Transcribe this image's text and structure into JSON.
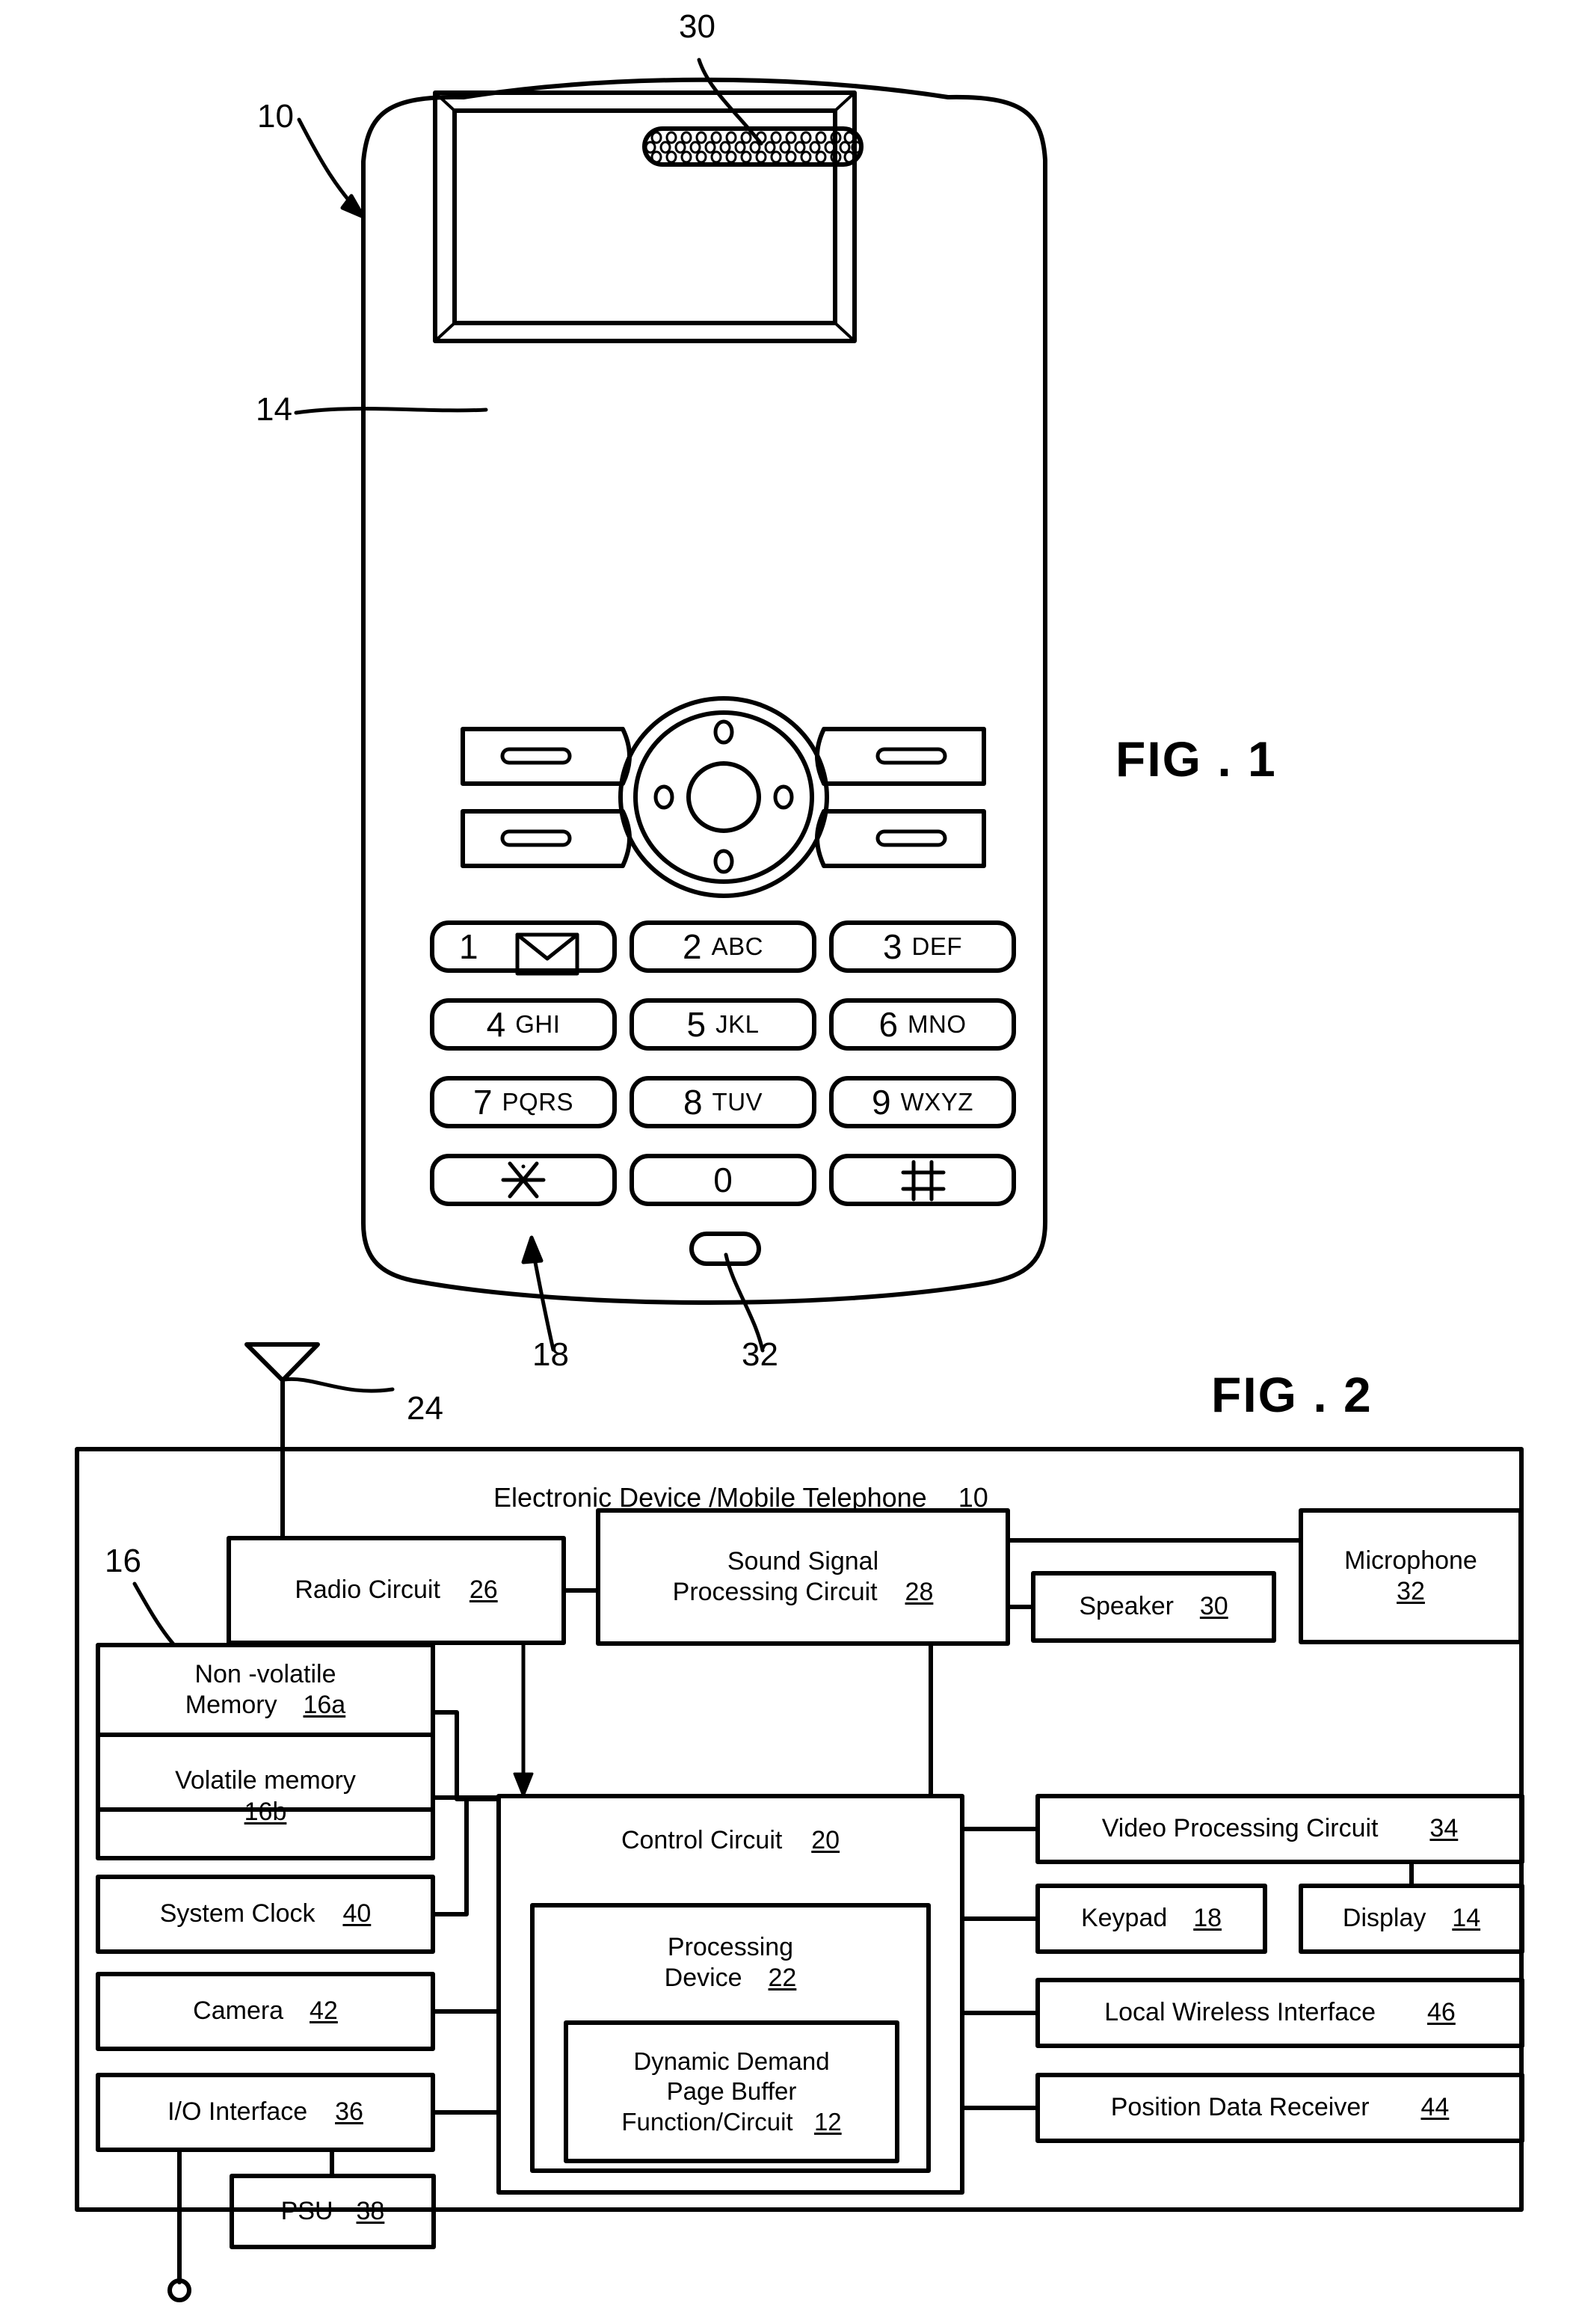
{
  "figures": [
    {
      "id": "fig1",
      "title": "FIG . 1"
    },
    {
      "id": "fig2",
      "title": "FIG . 2"
    }
  ],
  "fig1": {
    "title": "FIG . 1",
    "reference_labels": [
      {
        "name": "device-ref",
        "text": "10"
      },
      {
        "name": "speaker-ref",
        "text": "30"
      },
      {
        "name": "display-ref",
        "text": "14"
      },
      {
        "name": "keypad-ref",
        "text": "18"
      },
      {
        "name": "microphone-ref",
        "text": "32"
      }
    ],
    "softkeys": [
      {
        "name": "softkey-top-left",
        "label": ""
      },
      {
        "name": "softkey-top-right",
        "label": ""
      },
      {
        "name": "softkey-bottom-left",
        "label": ""
      },
      {
        "name": "softkey-bottom-right",
        "label": ""
      }
    ],
    "keypad": [
      {
        "digit": "1",
        "letters": "",
        "icon": "envelope-icon"
      },
      {
        "digit": "2",
        "letters": "ABC",
        "icon": ""
      },
      {
        "digit": "3",
        "letters": "DEF",
        "icon": ""
      },
      {
        "digit": "4",
        "letters": "GHI",
        "icon": ""
      },
      {
        "digit": "5",
        "letters": "JKL",
        "icon": ""
      },
      {
        "digit": "6",
        "letters": "MNO",
        "icon": ""
      },
      {
        "digit": "7",
        "letters": "PQRS",
        "icon": ""
      },
      {
        "digit": "8",
        "letters": "TUV",
        "icon": ""
      },
      {
        "digit": "9",
        "letters": "WXYZ",
        "icon": ""
      },
      {
        "digit": "",
        "letters": "",
        "icon": "asterisk-icon"
      },
      {
        "digit": "0",
        "letters": "",
        "icon": ""
      },
      {
        "digit": "",
        "letters": "",
        "icon": "hash-icon"
      }
    ]
  },
  "fig2": {
    "title": "FIG . 2",
    "diagram_title": {
      "text": "Electronic Device  /Mobile Telephone",
      "ref": "10"
    },
    "antenna_ref": "24",
    "memory_group_ref": "16",
    "blocks": [
      {
        "name": "radio-circuit-block",
        "line1": "Radio Circuit",
        "line2": "",
        "ref": "26"
      },
      {
        "name": "sound-signal-processing-block",
        "line1": "Sound Signal",
        "line2": "Processing Circuit",
        "ref": "28"
      },
      {
        "name": "speaker-block",
        "line1": "Speaker",
        "line2": "",
        "ref": "30"
      },
      {
        "name": "microphone-block",
        "line1": "Microphone",
        "line2": "",
        "ref": "32"
      },
      {
        "name": "non-volatile-memory-block",
        "line1": "Non -volatile",
        "line2": "Memory",
        "ref": "16a"
      },
      {
        "name": "volatile-memory-block",
        "line1": "Volatile memory",
        "line2": "",
        "ref": "16b"
      },
      {
        "name": "system-clock-block",
        "line1": "System Clock",
        "line2": "",
        "ref": "40"
      },
      {
        "name": "camera-block",
        "line1": "Camera",
        "line2": "",
        "ref": "42"
      },
      {
        "name": "io-interface-block",
        "line1": "I/O Interface",
        "line2": "",
        "ref": "36"
      },
      {
        "name": "psu-block",
        "line1": "PSU",
        "line2": "",
        "ref": "38"
      },
      {
        "name": "control-circuit-block",
        "line1": "Control Circuit",
        "line2": "",
        "ref": "20"
      },
      {
        "name": "processing-device-block",
        "line1": "Processing",
        "line2": "Device",
        "ref": "22"
      },
      {
        "name": "dynamic-demand-page-buffer-block",
        "line1": "Dynamic Demand",
        "line2": "Page Buffer",
        "line3": "Function/Circuit",
        "ref": "12"
      },
      {
        "name": "video-processing-circuit-block",
        "line1": "Video Processing Circuit",
        "line2": "",
        "ref": "34"
      },
      {
        "name": "keypad-block",
        "line1": "Keypad",
        "line2": "",
        "ref": "18"
      },
      {
        "name": "display-block",
        "line1": "Display",
        "line2": "",
        "ref": "14"
      },
      {
        "name": "local-wireless-interface-block",
        "line1": "Local Wireless Interface",
        "line2": "",
        "ref": "46"
      },
      {
        "name": "position-data-receiver-block",
        "line1": "Position Data Receiver",
        "line2": "",
        "ref": "44"
      }
    ]
  },
  "colors": {
    "ink": "#000000",
    "paper": "#ffffff"
  }
}
